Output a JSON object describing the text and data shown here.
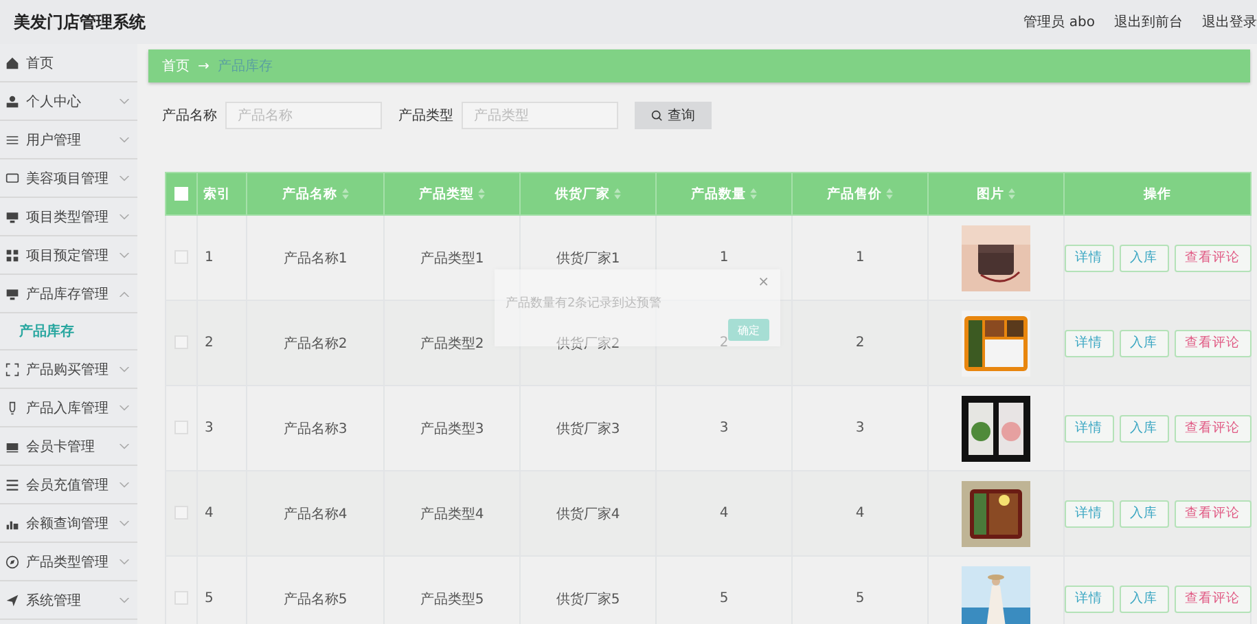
{
  "app_title": "美发门店管理系统",
  "header": {
    "user": "管理员 abo",
    "links": [
      "退出到前台",
      "退出登录"
    ]
  },
  "sidebar": {
    "items": [
      {
        "label": "首页",
        "kind": "link"
      },
      {
        "label": "个人中心",
        "kind": "menu",
        "expanded": false
      },
      {
        "label": "用户管理",
        "kind": "menu",
        "expanded": false
      },
      {
        "label": "美容项目管理",
        "kind": "menu",
        "expanded": false
      },
      {
        "label": "项目类型管理",
        "kind": "menu",
        "expanded": false
      },
      {
        "label": "项目预定管理",
        "kind": "menu",
        "expanded": false
      },
      {
        "label": "产品库存管理",
        "kind": "menu",
        "expanded": true,
        "children": [
          {
            "label": "产品库存",
            "selected": true
          }
        ]
      },
      {
        "label": "产品购买管理",
        "kind": "menu",
        "expanded": false
      },
      {
        "label": "产品入库管理",
        "kind": "menu",
        "expanded": false
      },
      {
        "label": "会员卡管理",
        "kind": "menu",
        "expanded": false
      },
      {
        "label": "会员充值管理",
        "kind": "menu",
        "expanded": false
      },
      {
        "label": "余额查询管理",
        "kind": "menu",
        "expanded": false
      },
      {
        "label": "产品类型管理",
        "kind": "menu",
        "expanded": false
      },
      {
        "label": "系统管理",
        "kind": "menu",
        "expanded": false
      }
    ]
  },
  "breadcrumb": {
    "items": [
      "首页",
      "产品库存"
    ],
    "separator": "→"
  },
  "search": {
    "fields": [
      {
        "label": "产品名称",
        "placeholder": "产品名称"
      },
      {
        "label": "产品类型",
        "placeholder": "产品类型"
      }
    ],
    "button": "查询"
  },
  "table": {
    "all_checked": false,
    "columns": [
      {
        "label": "索引",
        "sortable": false
      },
      {
        "label": "产品名称",
        "sortable": true
      },
      {
        "label": "产品类型",
        "sortable": true
      },
      {
        "label": "供货厂家",
        "sortable": true
      },
      {
        "label": "产品数量",
        "sortable": true
      },
      {
        "label": "产品售价",
        "sortable": true
      },
      {
        "label": "图片",
        "sortable": true
      },
      {
        "label": "操作",
        "sortable": false
      }
    ],
    "rows": [
      {
        "checked": false,
        "index": "1",
        "name": "产品名称1",
        "type": "产品类型1",
        "supplier": "供货厂家1",
        "quantity": "1",
        "price": "1",
        "actions": [
          {
            "label": "详情",
            "kind": "info"
          },
          {
            "label": "入库",
            "kind": "info"
          },
          {
            "label": "查看评论",
            "kind": "danger"
          }
        ]
      },
      {
        "checked": false,
        "index": "2",
        "name": "产品名称2",
        "type": "产品类型2",
        "supplier": "供货厂家2",
        "quantity": "2",
        "price": "2",
        "actions": [
          {
            "label": "详情",
            "kind": "info"
          },
          {
            "label": "入库",
            "kind": "info"
          },
          {
            "label": "查看评论",
            "kind": "danger"
          }
        ]
      },
      {
        "checked": false,
        "index": "3",
        "name": "产品名称3",
        "type": "产品类型3",
        "supplier": "供货厂家3",
        "quantity": "3",
        "price": "3",
        "actions": [
          {
            "label": "详情",
            "kind": "info"
          },
          {
            "label": "入库",
            "kind": "info"
          },
          {
            "label": "查看评论",
            "kind": "danger"
          }
        ]
      },
      {
        "checked": false,
        "index": "4",
        "name": "产品名称4",
        "type": "产品类型4",
        "supplier": "供货厂家4",
        "quantity": "4",
        "price": "4",
        "actions": [
          {
            "label": "详情",
            "kind": "info"
          },
          {
            "label": "入库",
            "kind": "info"
          },
          {
            "label": "查看评论",
            "kind": "danger"
          }
        ]
      },
      {
        "checked": false,
        "index": "5",
        "name": "产品名称5",
        "type": "产品类型5",
        "supplier": "供货厂家5",
        "quantity": "5",
        "price": "5",
        "actions": [
          {
            "label": "详情",
            "kind": "info"
          },
          {
            "label": "入库",
            "kind": "info"
          },
          {
            "label": "查看评论",
            "kind": "danger"
          }
        ]
      }
    ]
  },
  "dialog": {
    "message": "产品数量有2条记录到达预警",
    "close": "×",
    "button": "确定"
  }
}
